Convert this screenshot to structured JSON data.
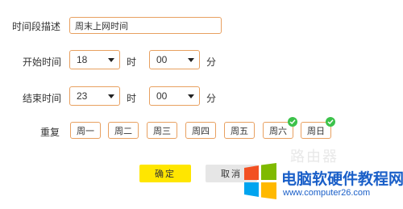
{
  "form": {
    "desc_label": "时间段描述",
    "desc_value": "周末上网时间",
    "start_label": "开始时间",
    "start_hour": "18",
    "start_min": "00",
    "end_label": "结束时间",
    "end_hour": "23",
    "end_min": "00",
    "hour_unit": "时",
    "min_unit": "分",
    "repeat_label": "重复",
    "days": [
      {
        "label": "周一",
        "checked": false
      },
      {
        "label": "周二",
        "checked": false
      },
      {
        "label": "周三",
        "checked": false
      },
      {
        "label": "周四",
        "checked": false
      },
      {
        "label": "周五",
        "checked": false
      },
      {
        "label": "周六",
        "checked": true
      },
      {
        "label": "周日",
        "checked": true
      }
    ],
    "ok_label": "确定",
    "cancel_label": "取消"
  },
  "watermark": {
    "title": "电脑软硬件教程网",
    "url": "www.computer26.com",
    "faint_text": "路由器"
  },
  "colors": {
    "input_border": "#e8a060",
    "ok_button": "#ffe600",
    "check_green": "#3cc24a",
    "watermark_blue": "#1a5fc8"
  }
}
